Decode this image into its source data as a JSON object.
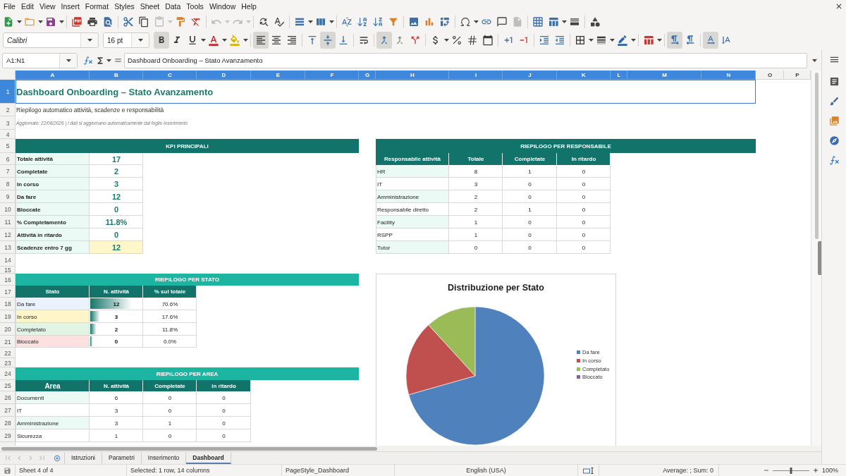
{
  "menu": [
    "File",
    "Edit",
    "View",
    "Insert",
    "Format",
    "Styles",
    "Sheet",
    "Data",
    "Tools",
    "Window",
    "Help"
  ],
  "standard_toolbar": {
    "paste_disabled": true,
    "undo_disabled": true,
    "redo_disabled": true,
    "headers_footers_disabled": true
  },
  "formatting_toolbar": {
    "font_name": "Calibri",
    "font_size": "16 pt",
    "bold": true,
    "italic": false,
    "underline": false,
    "align_left": true,
    "align_center": false,
    "align_right": false,
    "align_top": false,
    "align_middle": true,
    "align_bottom": false,
    "merge_and_center": true,
    "paragraph_ltr": true,
    "paragraph_rtl": false,
    "text_horizontal": true,
    "text_vertical": false
  },
  "formula_bar": {
    "name_box": "A1:N1",
    "content": "Dashboard Onboarding – Stato Avanzamento"
  },
  "column_headers": [
    {
      "label": "A",
      "selected": true
    },
    {
      "label": "B",
      "selected": true
    },
    {
      "label": "C",
      "selected": true
    },
    {
      "label": "D",
      "selected": true
    },
    {
      "label": "E",
      "selected": true
    },
    {
      "label": "F",
      "selected": true
    },
    {
      "label": "G",
      "selected": true
    },
    {
      "label": "H",
      "selected": true
    },
    {
      "label": "I",
      "selected": true
    },
    {
      "label": "J",
      "selected": true
    },
    {
      "label": "K",
      "selected": true
    },
    {
      "label": "L",
      "selected": true
    },
    {
      "label": "M",
      "selected": true
    },
    {
      "label": "N",
      "selected": true
    },
    {
      "label": "O",
      "selected": false
    },
    {
      "label": "P",
      "selected": false
    }
  ],
  "row_headers": [
    {
      "label": "1",
      "selected": true
    },
    {
      "label": "2",
      "selected": false
    },
    {
      "label": "3",
      "selected": false
    },
    {
      "label": "4",
      "selected": false
    },
    {
      "label": "5",
      "selected": false
    },
    {
      "label": "6",
      "selected": false
    },
    {
      "label": "7",
      "selected": false
    },
    {
      "label": "8",
      "selected": false
    },
    {
      "label": "9",
      "selected": false
    },
    {
      "label": "10",
      "selected": false
    },
    {
      "label": "11",
      "selected": false
    },
    {
      "label": "12",
      "selected": false
    },
    {
      "label": "13",
      "selected": false
    },
    {
      "label": "14",
      "selected": false
    },
    {
      "label": "15",
      "selected": false
    },
    {
      "label": "16",
      "selected": false
    },
    {
      "label": "17",
      "selected": false
    },
    {
      "label": "18",
      "selected": false
    },
    {
      "label": "19",
      "selected": false
    },
    {
      "label": "20",
      "selected": false
    },
    {
      "label": "21",
      "selected": false
    },
    {
      "label": "22",
      "selected": false
    },
    {
      "label": "23",
      "selected": false
    },
    {
      "label": "24",
      "selected": false
    },
    {
      "label": "25",
      "selected": false
    },
    {
      "label": "26",
      "selected": false
    },
    {
      "label": "27",
      "selected": false
    },
    {
      "label": "28",
      "selected": false
    },
    {
      "label": "29",
      "selected": false
    }
  ],
  "sheet": {
    "title": "Dashboard Onboarding – Stato Avanzamento",
    "subtitle": "Riepilogo automatico attività, scadenze e responsabilità",
    "note": "Aggiornato: 22/06/2026 | I dati si aggiornano automaticamente dal foglio Inserimento",
    "kpi": {
      "header": "KPI PRINCIPALI",
      "items": [
        {
          "label": "Totale attività",
          "value": "17",
          "highlighted": false
        },
        {
          "label": "Completate",
          "value": "2",
          "highlighted": false
        },
        {
          "label": "In corso",
          "value": "3",
          "highlighted": false
        },
        {
          "label": "Da fare",
          "value": "12",
          "highlighted": false
        },
        {
          "label": "Bloccate",
          "value": "0",
          "highlighted": false
        },
        {
          "label": "% Completamento",
          "value": "11.8%",
          "highlighted": false
        },
        {
          "label": "Attività in ritardo",
          "value": "0",
          "highlighted": false
        },
        {
          "label": "Scadenze entro 7 gg",
          "value": "12",
          "highlighted": true
        }
      ]
    },
    "by_owner": {
      "header": "RIEPILOGO PER RESPONSABILE",
      "columns": [
        "Responsabile attività",
        "Totale",
        "Completate",
        "In ritardo"
      ],
      "rows": [
        [
          "HR",
          "8",
          "1",
          "0"
        ],
        [
          "IT",
          "3",
          "0",
          "0"
        ],
        [
          "Amministrazione",
          "2",
          "0",
          "0"
        ],
        [
          "Responsabile diretto",
          "2",
          "1",
          "0"
        ],
        [
          "Facility",
          "1",
          "0",
          "0"
        ],
        [
          "RSPP",
          "1",
          "0",
          "0"
        ],
        [
          "Tutor",
          "0",
          "0",
          "0"
        ]
      ]
    },
    "by_status": {
      "header": "RIEPILOGO PER STATO",
      "columns": [
        "Stato",
        "N. attività",
        "% sul totale"
      ],
      "rows": [
        {
          "status": "Da fare",
          "color": "#eaf2fd",
          "count": "12",
          "level": 1,
          "share": "70.6%"
        },
        {
          "status": "In corso",
          "color": "#fff5c8",
          "count": "3",
          "level": 0.25,
          "share": "17.6%"
        },
        {
          "status": "Completato",
          "color": "#e2f5e4",
          "count": "2",
          "level": 0.17,
          "share": "11.8%"
        },
        {
          "status": "Bloccato",
          "color": "#fde0e0",
          "count": "0",
          "level": 0.08,
          "share": "0.0%"
        }
      ]
    },
    "by_area": {
      "header": "RIEPILOGO PER AREA",
      "columns": [
        "Area",
        "N. attività",
        "Completate",
        "In ritardo"
      ],
      "rows": [
        [
          "Documenti",
          "6",
          "0",
          "0"
        ],
        [
          "IT",
          "3",
          "0",
          "0"
        ],
        [
          "Amministrazione",
          "3",
          "1",
          "0"
        ],
        [
          "Sicurezza",
          "1",
          "0",
          "0"
        ]
      ]
    },
    "chart": {
      "chart_data": {
        "type": "pie",
        "title": "Distribuzione per Stato",
        "categories": [
          "Da fare",
          "In corso",
          "Completato",
          "Bloccato"
        ],
        "values": [
          70.6,
          17.6,
          11.8,
          0
        ],
        "legend": "right"
      }
    }
  },
  "sheet_tabs": [
    {
      "label": "Istruzioni",
      "selected": false
    },
    {
      "label": "Parametri",
      "selected": false
    },
    {
      "label": "Inserimento",
      "selected": false
    },
    {
      "label": "Dashboard",
      "selected": true
    }
  ],
  "status_bar": {
    "sheet": "Sheet 4 of 4",
    "selection": "Selected: 1 row, 14 columns",
    "page_style": "PageStyle_Dashboard",
    "language": "English (USA)",
    "summary": "Average: ; Sum: 0",
    "zoom": {
      "level": 0.5,
      "reading": "100%"
    }
  }
}
